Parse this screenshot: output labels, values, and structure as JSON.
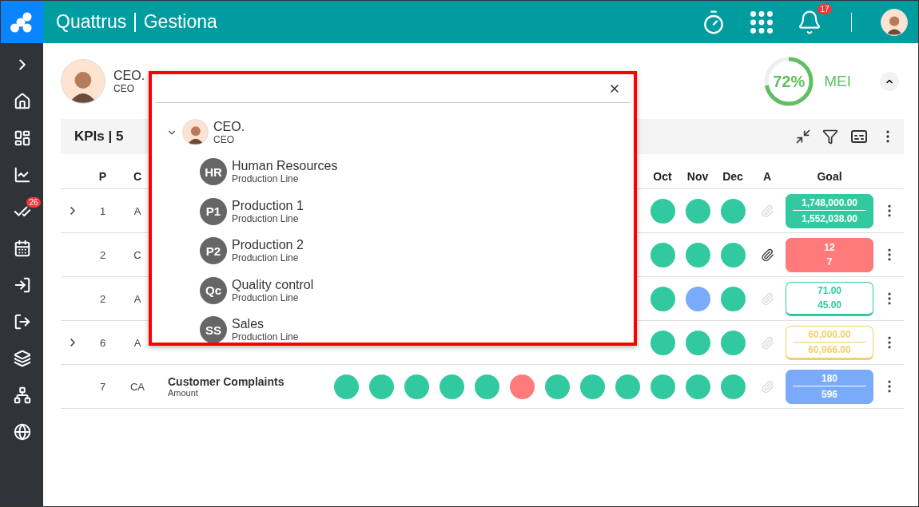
{
  "header": {
    "brand": "Quattrus",
    "product": "Gestiona",
    "notifications_badge": "17"
  },
  "sidebar": {
    "tasks_badge": "26"
  },
  "profile": {
    "name": "CEO.",
    "role": "CEO",
    "score": {
      "level": 0.72,
      "value": "72%",
      "label": "MEI"
    }
  },
  "kpi_bar": {
    "title": "KPIs | 5"
  },
  "table": {
    "columns": {
      "p": "P",
      "c": "C",
      "months": [
        "Oct",
        "Nov",
        "Dec"
      ],
      "a": "A",
      "goal": "Goal"
    },
    "rows": [
      {
        "expandable": true,
        "p": "1",
        "c": "A",
        "dots": [
          {
            "color": "#33c9a0"
          },
          {
            "color": "#33c9a0"
          },
          {
            "color": "#33c9a0"
          }
        ],
        "attached": false,
        "goal": {
          "kind": "solid",
          "color": "#33c9a0",
          "divider": true,
          "target": "1,748,000.00",
          "actual": "1,552,038.00"
        }
      },
      {
        "expandable": false,
        "p": "2",
        "c": "C",
        "dots": [
          {
            "color": "#33c9a0"
          },
          {
            "color": "#33c9a0"
          },
          {
            "color": "#33c9a0"
          }
        ],
        "attached": true,
        "goal": {
          "kind": "solid",
          "color": "#ff7b7b",
          "divider": false,
          "target": "12",
          "actual": "7"
        }
      },
      {
        "expandable": false,
        "p": "2",
        "c": "A",
        "dots": [
          {
            "color": "#33c9a0"
          },
          {
            "color": "#7aabfa"
          },
          {
            "color": "#33c9a0"
          }
        ],
        "attached": false,
        "goal": {
          "kind": "outline",
          "color": "#33c9a0",
          "divider": false,
          "target": "71.00",
          "actual": "45.00"
        }
      },
      {
        "expandable": true,
        "p": "6",
        "c": "A",
        "dots": [
          {
            "color": "#33c9a0"
          },
          {
            "color": "#33c9a0"
          },
          {
            "color": "#33c9a0"
          }
        ],
        "attached": false,
        "goal": {
          "kind": "outline",
          "color": "#f2cf6b",
          "divider": true,
          "target": "60,000.00",
          "actual": "60,966.00"
        }
      },
      {
        "expandable": false,
        "p": "7",
        "c": "CA",
        "name": "Customer Complaints",
        "unit": "Amount",
        "dots": [
          {
            "color": "#33c9a0"
          },
          {
            "color": "#33c9a0"
          },
          {
            "color": "#33c9a0"
          },
          {
            "color": "#33c9a0"
          },
          {
            "color": "#33c9a0"
          },
          {
            "color": "#ff7b7b"
          },
          {
            "color": "#33c9a0"
          },
          {
            "color": "#33c9a0"
          },
          {
            "color": "#33c9a0"
          },
          {
            "color": "#33c9a0"
          },
          {
            "color": "#33c9a0"
          },
          {
            "color": "#33c9a0"
          }
        ],
        "attached": false,
        "goal": {
          "kind": "solid",
          "color": "#7aabfa",
          "divider": true,
          "target": "180",
          "actual": "596"
        }
      }
    ]
  },
  "popup": {
    "root": {
      "name": "CEO.",
      "role": "CEO",
      "expanded": true,
      "children": [
        {
          "initials": "HR",
          "name": "Human Resources",
          "type": "Production Line"
        },
        {
          "initials": "P1",
          "name": "Production 1",
          "type": "Production Line"
        },
        {
          "initials": "P2",
          "name": "Production 2",
          "type": "Production Line"
        },
        {
          "initials": "Qc",
          "name": "Quality control",
          "type": "Production Line"
        },
        {
          "initials": "SS",
          "name": "Sales",
          "type": "Production Line"
        }
      ]
    }
  }
}
